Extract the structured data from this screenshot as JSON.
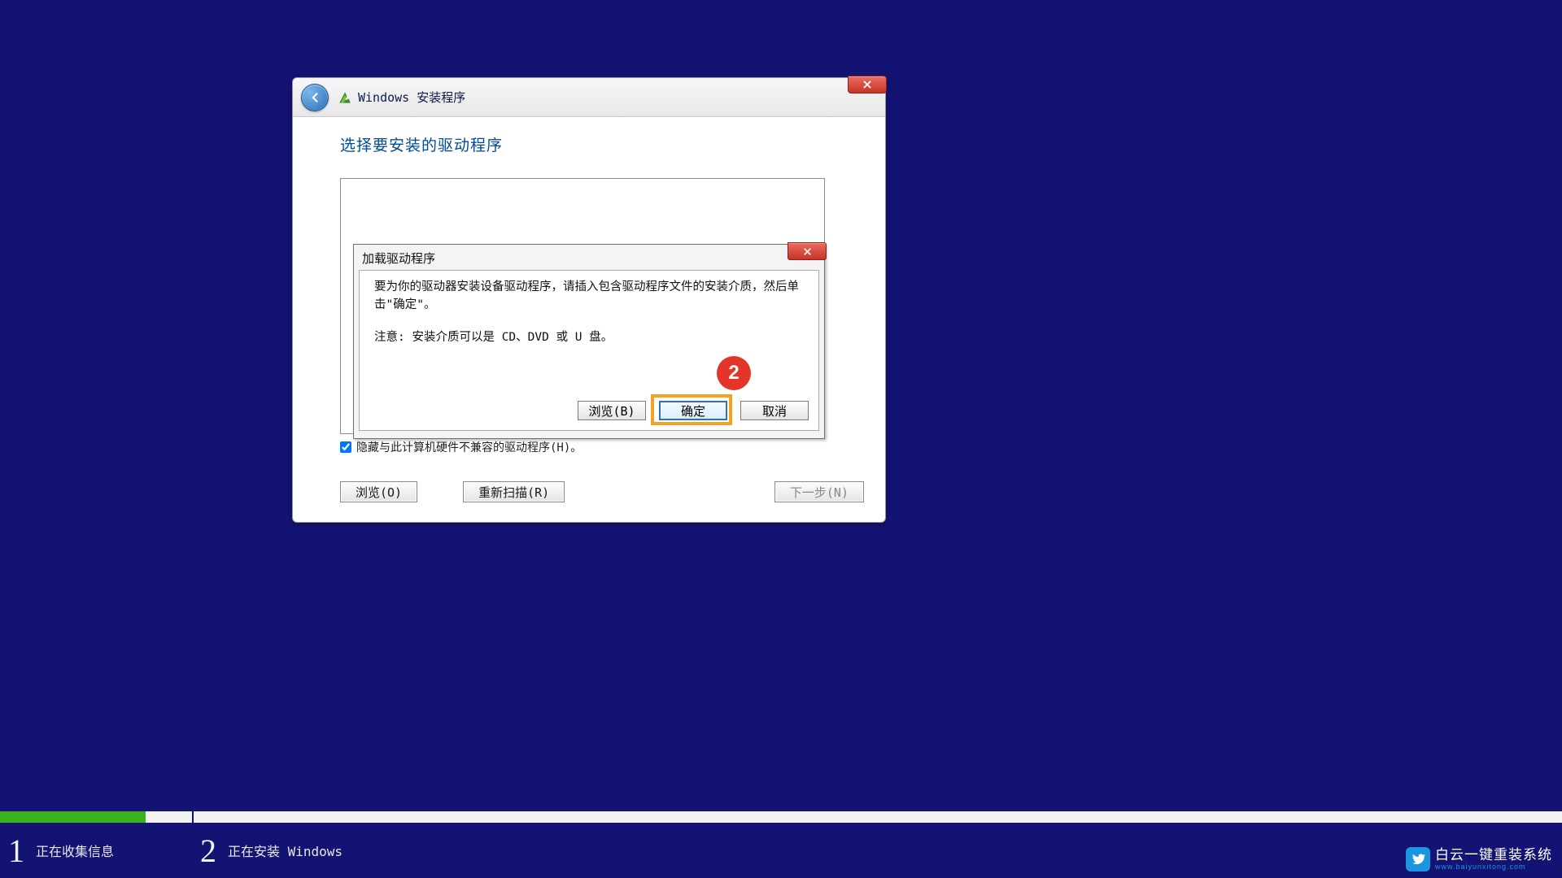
{
  "window": {
    "title": "Windows 安装程序",
    "heading": "选择要安装的驱动程序",
    "hide_incompatible_label": "隐藏与此计算机硬件不兼容的驱动程序(H)。",
    "buttons": {
      "browse": "浏览(O)",
      "rescan": "重新扫描(R)",
      "next": "下一步(N)"
    }
  },
  "modal": {
    "title": "加载驱动程序",
    "message": "要为你的驱动器安装设备驱动程序，请插入包含驱动程序文件的安装介质，然后单击\"确定\"。",
    "note": "注意: 安装介质可以是 CD、DVD 或 U 盘。",
    "buttons": {
      "browse": "浏览(B)",
      "ok": "确定",
      "cancel": "取消"
    }
  },
  "annotation": {
    "step_number": "2"
  },
  "progress": {
    "step1_label": "正在收集信息",
    "step2_label": "正在安装 Windows",
    "fill_percent": 9.3,
    "divider_percent": 12.3
  },
  "watermark": {
    "brand": "白云一键重装系统",
    "url": "www.baiyunxitong.com"
  }
}
